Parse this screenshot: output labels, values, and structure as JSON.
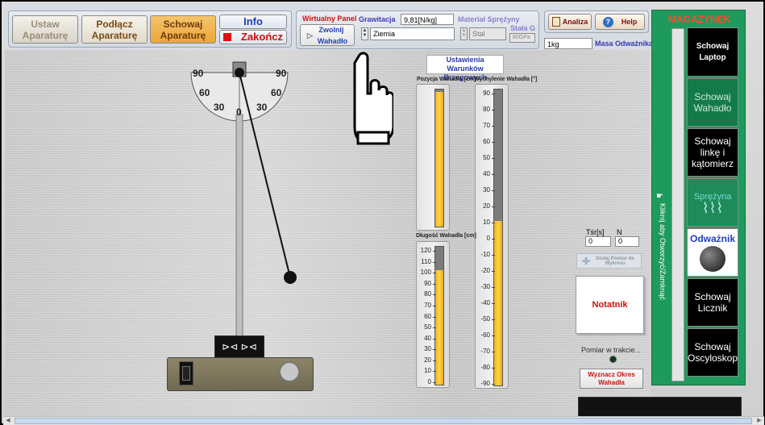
{
  "toolbar": {
    "ustaw_label": "Ustaw Aparaturę",
    "podlacz_label": "Podłącz Aparaturę",
    "schowaj_label": "Schowaj Aparaturę",
    "info_label": "Info",
    "zakoncz_label": "Zakończ"
  },
  "panel": {
    "virtual_title": "Wirtualny Panel",
    "release_label": "Zwolnij Wahadło",
    "gravity_label": "Grawitacja",
    "gravity_value": "9,81[N/kg]",
    "gravity_selected": "Ziemia",
    "spring_material_label": "Materiał Sprężyny",
    "spring_material_value": "Stal",
    "stala_g_label": "Stała G",
    "stala_g_value": "80GPa",
    "mass_value": "1kg",
    "mass_label": "Masa Odważnika"
  },
  "actions": {
    "analiza_label": "Analiza",
    "help_label": "Help"
  },
  "boundary": {
    "title": "Ustawienia Warunków Brzegowych",
    "position_label": "Pozycja Wahadła [cm]",
    "position_fill": 0.98,
    "deflection_label": "Wychylenie Wahadła [°]",
    "deflection_ticks": [
      "90",
      "80",
      "70",
      "60",
      "50",
      "40",
      "30",
      "20",
      "10",
      "0",
      "-10",
      "-20",
      "-30",
      "-40",
      "-50",
      "-60",
      "-70",
      "-80",
      "-90"
    ],
    "deflection_value": 10,
    "length_label": "Długość Wahadła [cm]",
    "length_ticks": [
      "120",
      "110",
      "100",
      "90",
      "80",
      "70",
      "60",
      "50",
      "40",
      "30",
      "20",
      "10",
      "0"
    ],
    "length_value": 100
  },
  "protractor": {
    "labels": [
      "90",
      "90",
      "60",
      "60",
      "30",
      "30",
      "0"
    ]
  },
  "measure": {
    "tsr_label": "Tśr[s]",
    "tsr_value": "0",
    "n_label": "N",
    "n_value": "0",
    "add_label": "Dodaj Pomiar do Wykresu",
    "notepad_label": "Notatnik",
    "in_progress_label": "Pomiar w trakcie...",
    "period_label": "Wyznacz Okres Wahadła"
  },
  "magazine": {
    "title": "MAGAZYNEK",
    "toggle_text": "Kliknij aby Otworzyć/Zamknąć",
    "items": [
      {
        "label": "Schowaj Laptop"
      },
      {
        "label": "Schowaj Wahadło"
      },
      {
        "label": "Schowaj linkę i kątomierz"
      },
      {
        "label": "Sprężyna"
      },
      {
        "label": "Odważnik"
      },
      {
        "label": "Schowaj Licznik"
      },
      {
        "label": "Schowaj Oscyloskop"
      }
    ]
  },
  "colors": {
    "accent_green": "#1f9a5d",
    "gauge_fill": "#f0b020",
    "danger_red": "#cc1010"
  }
}
